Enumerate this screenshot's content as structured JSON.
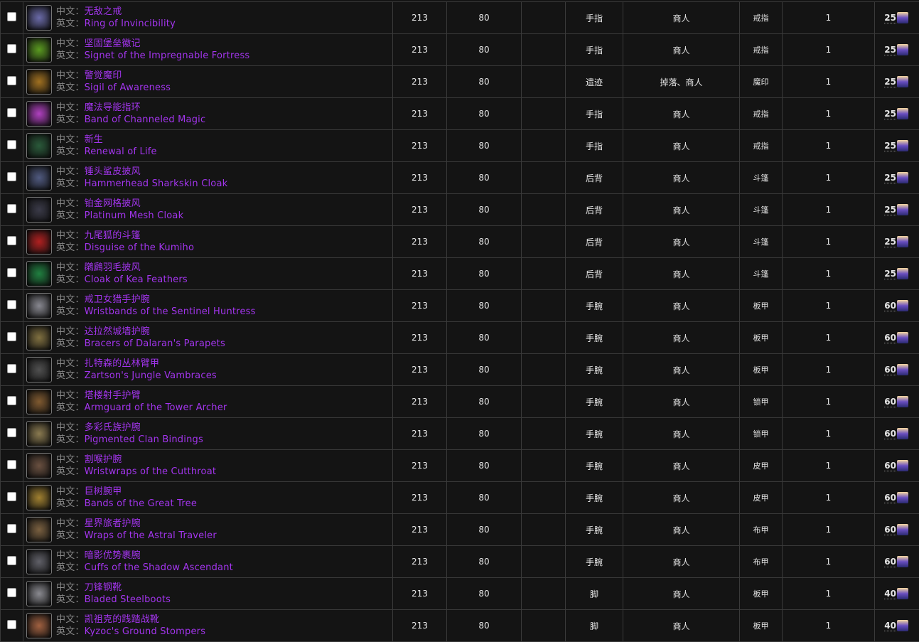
{
  "labels": {
    "cn": "中文：",
    "en": "英文："
  },
  "rows": [
    {
      "cn": "无敌之戒",
      "en": "Ring of Invincibility",
      "ilvl": "213",
      "level": "80",
      "extra": "",
      "slot": "手指",
      "source": "商人",
      "type": "戒指",
      "qty": "1",
      "cost": "25",
      "icon_color": "#6a6aa8"
    },
    {
      "cn": "坚固堡垒徽记",
      "en": "Signet of the Impregnable Fortress",
      "ilvl": "213",
      "level": "80",
      "extra": "",
      "slot": "手指",
      "source": "商人",
      "type": "戒指",
      "qty": "1",
      "cost": "25",
      "icon_color": "#5a9a20"
    },
    {
      "cn": "警觉魔印",
      "en": "Sigil of Awareness",
      "ilvl": "213",
      "level": "80",
      "extra": "",
      "slot": "遗迹",
      "source": "掉落、商人",
      "type": "魔印",
      "qty": "1",
      "cost": "25",
      "icon_color": "#a07020"
    },
    {
      "cn": "魔法导能指环",
      "en": "Band of Channeled Magic",
      "ilvl": "213",
      "level": "80",
      "extra": "",
      "slot": "手指",
      "source": "商人",
      "type": "戒指",
      "qty": "1",
      "cost": "25",
      "icon_color": "#b040c0"
    },
    {
      "cn": "新生",
      "en": "Renewal of Life",
      "ilvl": "213",
      "level": "80",
      "extra": "",
      "slot": "手指",
      "source": "商人",
      "type": "戒指",
      "qty": "1",
      "cost": "25",
      "icon_color": "#2a5a3a"
    },
    {
      "cn": "锤头鲨皮披风",
      "en": "Hammerhead Sharkskin Cloak",
      "ilvl": "213",
      "level": "80",
      "extra": "",
      "slot": "后背",
      "source": "商人",
      "type": "斗篷",
      "qty": "1",
      "cost": "25",
      "icon_color": "#505a80"
    },
    {
      "cn": "铂金网格披风",
      "en": "Platinum Mesh Cloak",
      "ilvl": "213",
      "level": "80",
      "extra": "",
      "slot": "后背",
      "source": "商人",
      "type": "斗篷",
      "qty": "1",
      "cost": "25",
      "icon_color": "#3a3a48"
    },
    {
      "cn": "九尾狐的斗篷",
      "en": "Disguise of the Kumiho",
      "ilvl": "213",
      "level": "80",
      "extra": "",
      "slot": "后背",
      "source": "商人",
      "type": "斗篷",
      "qty": "1",
      "cost": "25",
      "icon_color": "#b02020"
    },
    {
      "cn": "鸊鷉羽毛披风",
      "en": "Cloak of Kea Feathers",
      "ilvl": "213",
      "level": "80",
      "extra": "",
      "slot": "后背",
      "source": "商人",
      "type": "斗篷",
      "qty": "1",
      "cost": "25",
      "icon_color": "#208040"
    },
    {
      "cn": "戒卫女猎手护腕",
      "en": "Wristbands of the Sentinel Huntress",
      "ilvl": "213",
      "level": "80",
      "extra": "",
      "slot": "手腕",
      "source": "商人",
      "type": "板甲",
      "qty": "1",
      "cost": "60",
      "icon_color": "#888890"
    },
    {
      "cn": "达拉然城墙护腕",
      "en": "Bracers of Dalaran's Parapets",
      "ilvl": "213",
      "level": "80",
      "extra": "",
      "slot": "手腕",
      "source": "商人",
      "type": "板甲",
      "qty": "1",
      "cost": "60",
      "icon_color": "#807040"
    },
    {
      "cn": "扎特森的丛林臂甲",
      "en": "Zartson's Jungle Vambraces",
      "ilvl": "213",
      "level": "80",
      "extra": "",
      "slot": "手腕",
      "source": "商人",
      "type": "板甲",
      "qty": "1",
      "cost": "60",
      "icon_color": "#505050"
    },
    {
      "cn": "塔楼射手护臂",
      "en": "Armguard of the Tower Archer",
      "ilvl": "213",
      "level": "80",
      "extra": "",
      "slot": "手腕",
      "source": "商人",
      "type": "锁甲",
      "qty": "1",
      "cost": "60",
      "icon_color": "#805a30"
    },
    {
      "cn": "多彩氏族护腕",
      "en": "Pigmented Clan Bindings",
      "ilvl": "213",
      "level": "80",
      "extra": "",
      "slot": "手腕",
      "source": "商人",
      "type": "锁甲",
      "qty": "1",
      "cost": "60",
      "icon_color": "#8a7a50"
    },
    {
      "cn": "割喉护腕",
      "en": "Wristwraps of the Cutthroat",
      "ilvl": "213",
      "level": "80",
      "extra": "",
      "slot": "手腕",
      "source": "商人",
      "type": "皮甲",
      "qty": "1",
      "cost": "60",
      "icon_color": "#6a5040"
    },
    {
      "cn": "巨树腕甲",
      "en": "Bands of the Great Tree",
      "ilvl": "213",
      "level": "80",
      "extra": "",
      "slot": "手腕",
      "source": "商人",
      "type": "皮甲",
      "qty": "1",
      "cost": "60",
      "icon_color": "#a08030"
    },
    {
      "cn": "星界旅者护腕",
      "en": "Wraps of the Astral Traveler",
      "ilvl": "213",
      "level": "80",
      "extra": "",
      "slot": "手腕",
      "source": "商人",
      "type": "布甲",
      "qty": "1",
      "cost": "60",
      "icon_color": "#7a6040"
    },
    {
      "cn": "暗影优势裹腕",
      "en": "Cuffs of the Shadow Ascendant",
      "ilvl": "213",
      "level": "80",
      "extra": "",
      "slot": "手腕",
      "source": "商人",
      "type": "布甲",
      "qty": "1",
      "cost": "60",
      "icon_color": "#606068"
    },
    {
      "cn": "刀锋钢靴",
      "en": "Bladed Steelboots",
      "ilvl": "213",
      "level": "80",
      "extra": "",
      "slot": "脚",
      "source": "商人",
      "type": "板甲",
      "qty": "1",
      "cost": "40",
      "icon_color": "#8a8a90"
    },
    {
      "cn": "凯祖克的践踏战靴",
      "en": "Kyzoc's Ground Stompers",
      "ilvl": "213",
      "level": "80",
      "extra": "",
      "slot": "脚",
      "source": "商人",
      "type": "板甲",
      "qty": "1",
      "cost": "40",
      "icon_color": "#a06040"
    }
  ]
}
